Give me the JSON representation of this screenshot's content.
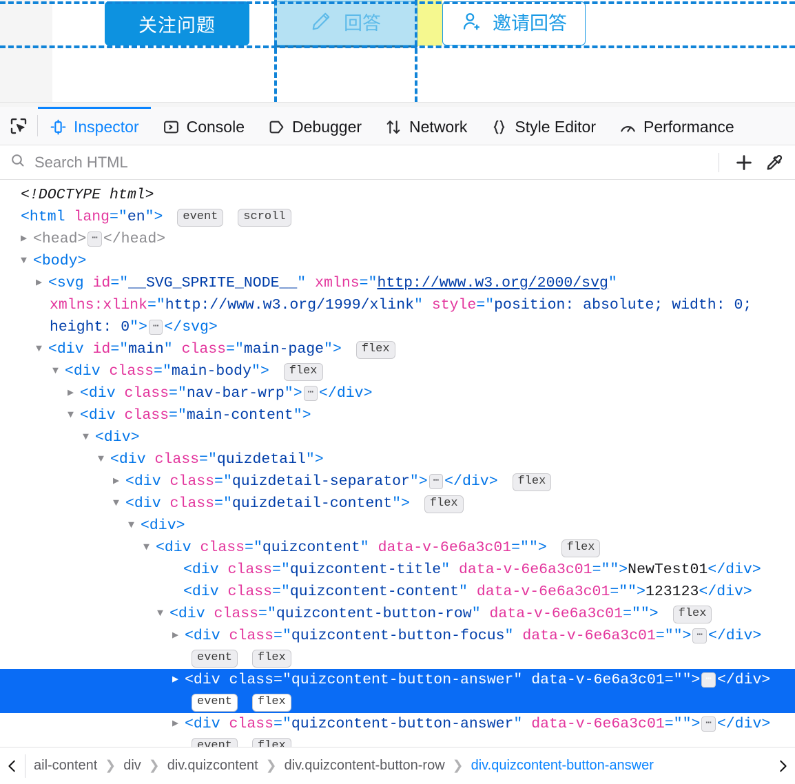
{
  "page": {
    "buttons": {
      "follow": "关注问题",
      "answer": "回答",
      "invite": "邀请回答"
    },
    "icons": {
      "pencil": "pencil-icon",
      "user_plus": "user-plus-icon"
    },
    "highlighter": {
      "content_color": "#87ceeb",
      "margin_color": "#f1f560",
      "guide_color": "#1184d8"
    }
  },
  "devtools": {
    "picker_icon": "element-picker-icon",
    "tabs": [
      {
        "label": "Inspector",
        "icon": "inspector-icon",
        "active": true
      },
      {
        "label": "Console",
        "icon": "console-icon",
        "active": false
      },
      {
        "label": "Debugger",
        "icon": "debugger-icon",
        "active": false
      },
      {
        "label": "Network",
        "icon": "network-icon",
        "active": false
      },
      {
        "label": "Style Editor",
        "icon": "style-editor-icon",
        "active": false
      },
      {
        "label": "Performance",
        "icon": "performance-icon",
        "active": false
      }
    ],
    "search": {
      "placeholder": "Search HTML",
      "value": "",
      "icon": "search-icon"
    },
    "search_actions": [
      {
        "name": "add-node-button",
        "icon": "plus-icon"
      },
      {
        "name": "eyedropper-button",
        "icon": "eyedropper-icon"
      }
    ],
    "markup": {
      "doctype": "<!DOCTYPE html>",
      "html_tag": "html",
      "html_attr_name": "lang",
      "html_attr_value": "en",
      "html_badges": [
        "event",
        "scroll"
      ],
      "head_tag": "head",
      "body_tag": "body",
      "svg": {
        "tag": "svg",
        "attr1_name": "id",
        "attr1_value": "__SVG_SPRITE_NODE__",
        "attr2_name": "xmlns",
        "attr2_value": "http://www.w3.org/2000/svg",
        "attr3_name": "xmlns:xlink",
        "attr3_value": "http://www.w3.org/1999/xlink",
        "attr4_name": "style",
        "attr4_value": "position: absolute; width: 0; height: 0"
      },
      "nodes": [
        {
          "tag": "div",
          "attrs": "id=\"main\" class=\"main-page\"",
          "badges": [
            "flex"
          ]
        },
        {
          "tag": "div",
          "attrs": "class=\"main-body\"",
          "badges": [
            "flex"
          ]
        },
        {
          "tag": "div",
          "attrs": "class=\"nav-bar-wrp\"",
          "badges": []
        },
        {
          "tag": "div",
          "attrs": "class=\"main-content\"",
          "badges": []
        },
        {
          "tag": "div",
          "attrs": "",
          "badges": []
        },
        {
          "tag": "div",
          "attrs": "class=\"quizdetail\"",
          "badges": []
        },
        {
          "tag": "div",
          "attrs": "class=\"quizdetail-separator\"",
          "badges": [
            "flex"
          ]
        },
        {
          "tag": "div",
          "attrs": "class=\"quizdetail-content\"",
          "badges": [
            "flex"
          ]
        },
        {
          "tag": "div",
          "attrs": "",
          "badges": []
        },
        {
          "tag": "div",
          "attrs": "class=\"quizcontent\" data-v-6e6a3c01=\"\"",
          "badges": [
            "flex"
          ]
        }
      ],
      "labels": {
        "main_id_name": "id",
        "main_id_value": "main",
        "class_name": "class",
        "data_v_name": "data-v-6e6a3c01",
        "data_v_value": "",
        "main_page_class": "main-page",
        "main_body_class": "main-body",
        "nav_bar_class": "nav-bar-wrp",
        "main_content_class": "main-content",
        "quizdetail_class": "quizdetail",
        "quizdetail_separator_class": "quizdetail-separator",
        "quizdetail_content_class": "quizdetail-content",
        "quizcontent_class": "quizcontent",
        "quizcontent_title_class": "quizcontent-title",
        "quizcontent_title_text": "NewTest01",
        "quizcontent_content_class": "quizcontent-content",
        "quizcontent_content_text": "123123",
        "quizcontent_button_row_class": "quizcontent-button-row",
        "quizcontent_button_focus_class": "quizcontent-button-focus",
        "quizcontent_button_answer_class": "quizcontent-button-answer",
        "badge_flex": "flex",
        "badge_event": "event",
        "badge_scroll": "scroll"
      }
    },
    "breadcrumbs": {
      "scroll_left_icon": "chevron-left-icon",
      "scroll_right_icon": "chevron-right-icon",
      "separator": "❯",
      "items": [
        {
          "label": "ail-content",
          "current": false
        },
        {
          "label": "div",
          "current": false
        },
        {
          "label": "div.quizcontent",
          "current": false
        },
        {
          "label": "div.quizcontent-button-row",
          "current": false
        },
        {
          "label": "div.quizcontent-button-answer",
          "current": true
        }
      ]
    }
  }
}
